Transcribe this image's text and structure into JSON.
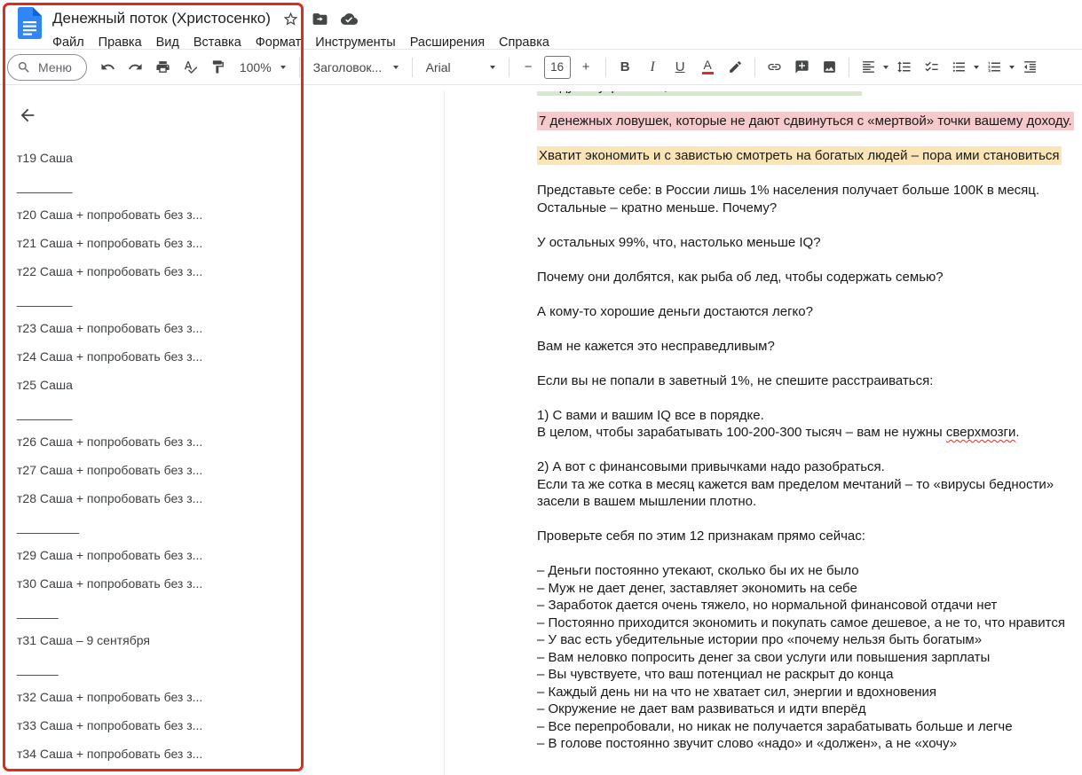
{
  "annotation": {
    "color": "#e22b1d"
  },
  "header": {
    "title": "Денежный поток (Христосенко)",
    "menus": [
      {
        "label": "Файл"
      },
      {
        "label": "Правка"
      },
      {
        "label": "Вид"
      },
      {
        "label": "Вставка"
      },
      {
        "label": "Формат"
      },
      {
        "label": "Инструменты"
      },
      {
        "label": "Расширения"
      },
      {
        "label": "Справка"
      }
    ]
  },
  "toolbar": {
    "menu_button_label": "Меню",
    "zoom_value": "100%",
    "style_value": "Заголовок...",
    "font_value": "Arial",
    "font_size_value": "16",
    "minus_label": "−",
    "plus_label": "+",
    "bold_label": "B",
    "italic_label": "I",
    "underline_label": "U",
    "text_color_label": "A"
  },
  "outline": {
    "items": [
      {
        "label": "т19 Саша"
      },
      {
        "label": "________",
        "divider": true
      },
      {
        "label": "т20 Саша + попробовать без з..."
      },
      {
        "label": "т21 Саша + попробовать без з..."
      },
      {
        "label": "т22 Саша + попробовать без з..."
      },
      {
        "label": "________",
        "divider": true
      },
      {
        "label": "т23 Саша + попробовать без з..."
      },
      {
        "label": "т24 Саша + попробовать без з..."
      },
      {
        "label": "т25 Саша"
      },
      {
        "label": "________",
        "divider": true
      },
      {
        "label": "т26 Саша + попробовать без з..."
      },
      {
        "label": "т27 Саша + попробовать без з..."
      },
      {
        "label": "т28 Саша + попробовать без з..."
      },
      {
        "label": "_________",
        "divider": true
      },
      {
        "label": "т29 Саша + попробовать без з..."
      },
      {
        "label": "т30 Саша + попробовать без з..."
      },
      {
        "label": "______",
        "divider": true
      },
      {
        "label": "т31 Саша – 9 сентября"
      },
      {
        "label": "______",
        "divider": true
      },
      {
        "label": "т32 Саша + попробовать без з..."
      },
      {
        "label": "т33 Саша + попробовать без з..."
      },
      {
        "label": "т34 Саша + попробовать без з..."
      }
    ]
  },
  "document": {
    "highlight_colors": {
      "green": "#d7e8cf",
      "pink": "#f6c9cc",
      "yellow": "#fbe5b6"
    },
    "blocks": [
      {
        "highlight": "green",
        "clipped": true,
        "lines": [
          "зайдут внутрь поста, чтобы не оказаться в их числе"
        ]
      },
      {
        "highlight": "pink",
        "lines": [
          "7 денежных ловушек, которые не дают сдвинуться с «мертвой» точки вашему доходу."
        ]
      },
      {
        "highlight": "yellow",
        "lines": [
          "Хватит экономить и с завистью смотреть на богатых людей – пора ими становиться"
        ]
      },
      {
        "lines": [
          "Представьте себе: в России лишь 1% населения получает больше 100К в месяц.",
          "Остальные – кратно меньше. Почему?"
        ]
      },
      {
        "lines": [
          "У остальных 99%, что, настолько меньше IQ?"
        ]
      },
      {
        "lines": [
          "Почему они долбятся, как рыба об лед, чтобы содержать семью?"
        ]
      },
      {
        "lines": [
          "А кому-то хорошие деньги достаются легко?"
        ]
      },
      {
        "lines": [
          "Вам не кажется это несправедливым?"
        ]
      },
      {
        "lines": [
          "Если вы не попали в заветный 1%, не спешите расстраиваться:"
        ]
      },
      {
        "misspelled": "сверхмозги",
        "lines": [
          "1) С вами и вашим IQ все в порядке.",
          "В целом, чтобы зарабатывать 100-200-300 тысяч – вам не нужны сверхмозги."
        ]
      },
      {
        "lines": [
          "2) А вот с финансовыми привычками надо разобраться.",
          "Если та же сотка в месяц кажется вам пределом мечтаний – то «вирусы бедности»",
          "засели в вашем мышлении плотно."
        ]
      },
      {
        "lines": [
          "Проверьте себя по этим 12 признакам прямо сейчас:"
        ]
      },
      {
        "lines": [
          "– Деньги постоянно утекают, сколько бы их не было",
          "– Муж не дает денег, заставляет экономить на себе",
          "– Заработок дается очень тяжело, но нормальной финансовой отдачи нет",
          "– Постоянно приходится экономить и покупать самое дешевое, а не то, что нравится",
          "– У вас есть убедительные истории про «почему нельзя быть богатым»",
          "– Вам неловко попросить денег за свои услуги или повышения зарплаты",
          "– Вы чувствуете, что ваш потенциал не раскрыт до конца",
          "– Каждый день ни на что не хватает сил, энергии и вдохновения",
          "– Окружение не дает вам развиваться и идти вперёд",
          "– Все перепробовали, но никак не получается зарабатывать больше и легче",
          "– В голове постоянно звучит слово «надо» и «должен», а не «хочу»"
        ]
      }
    ]
  }
}
